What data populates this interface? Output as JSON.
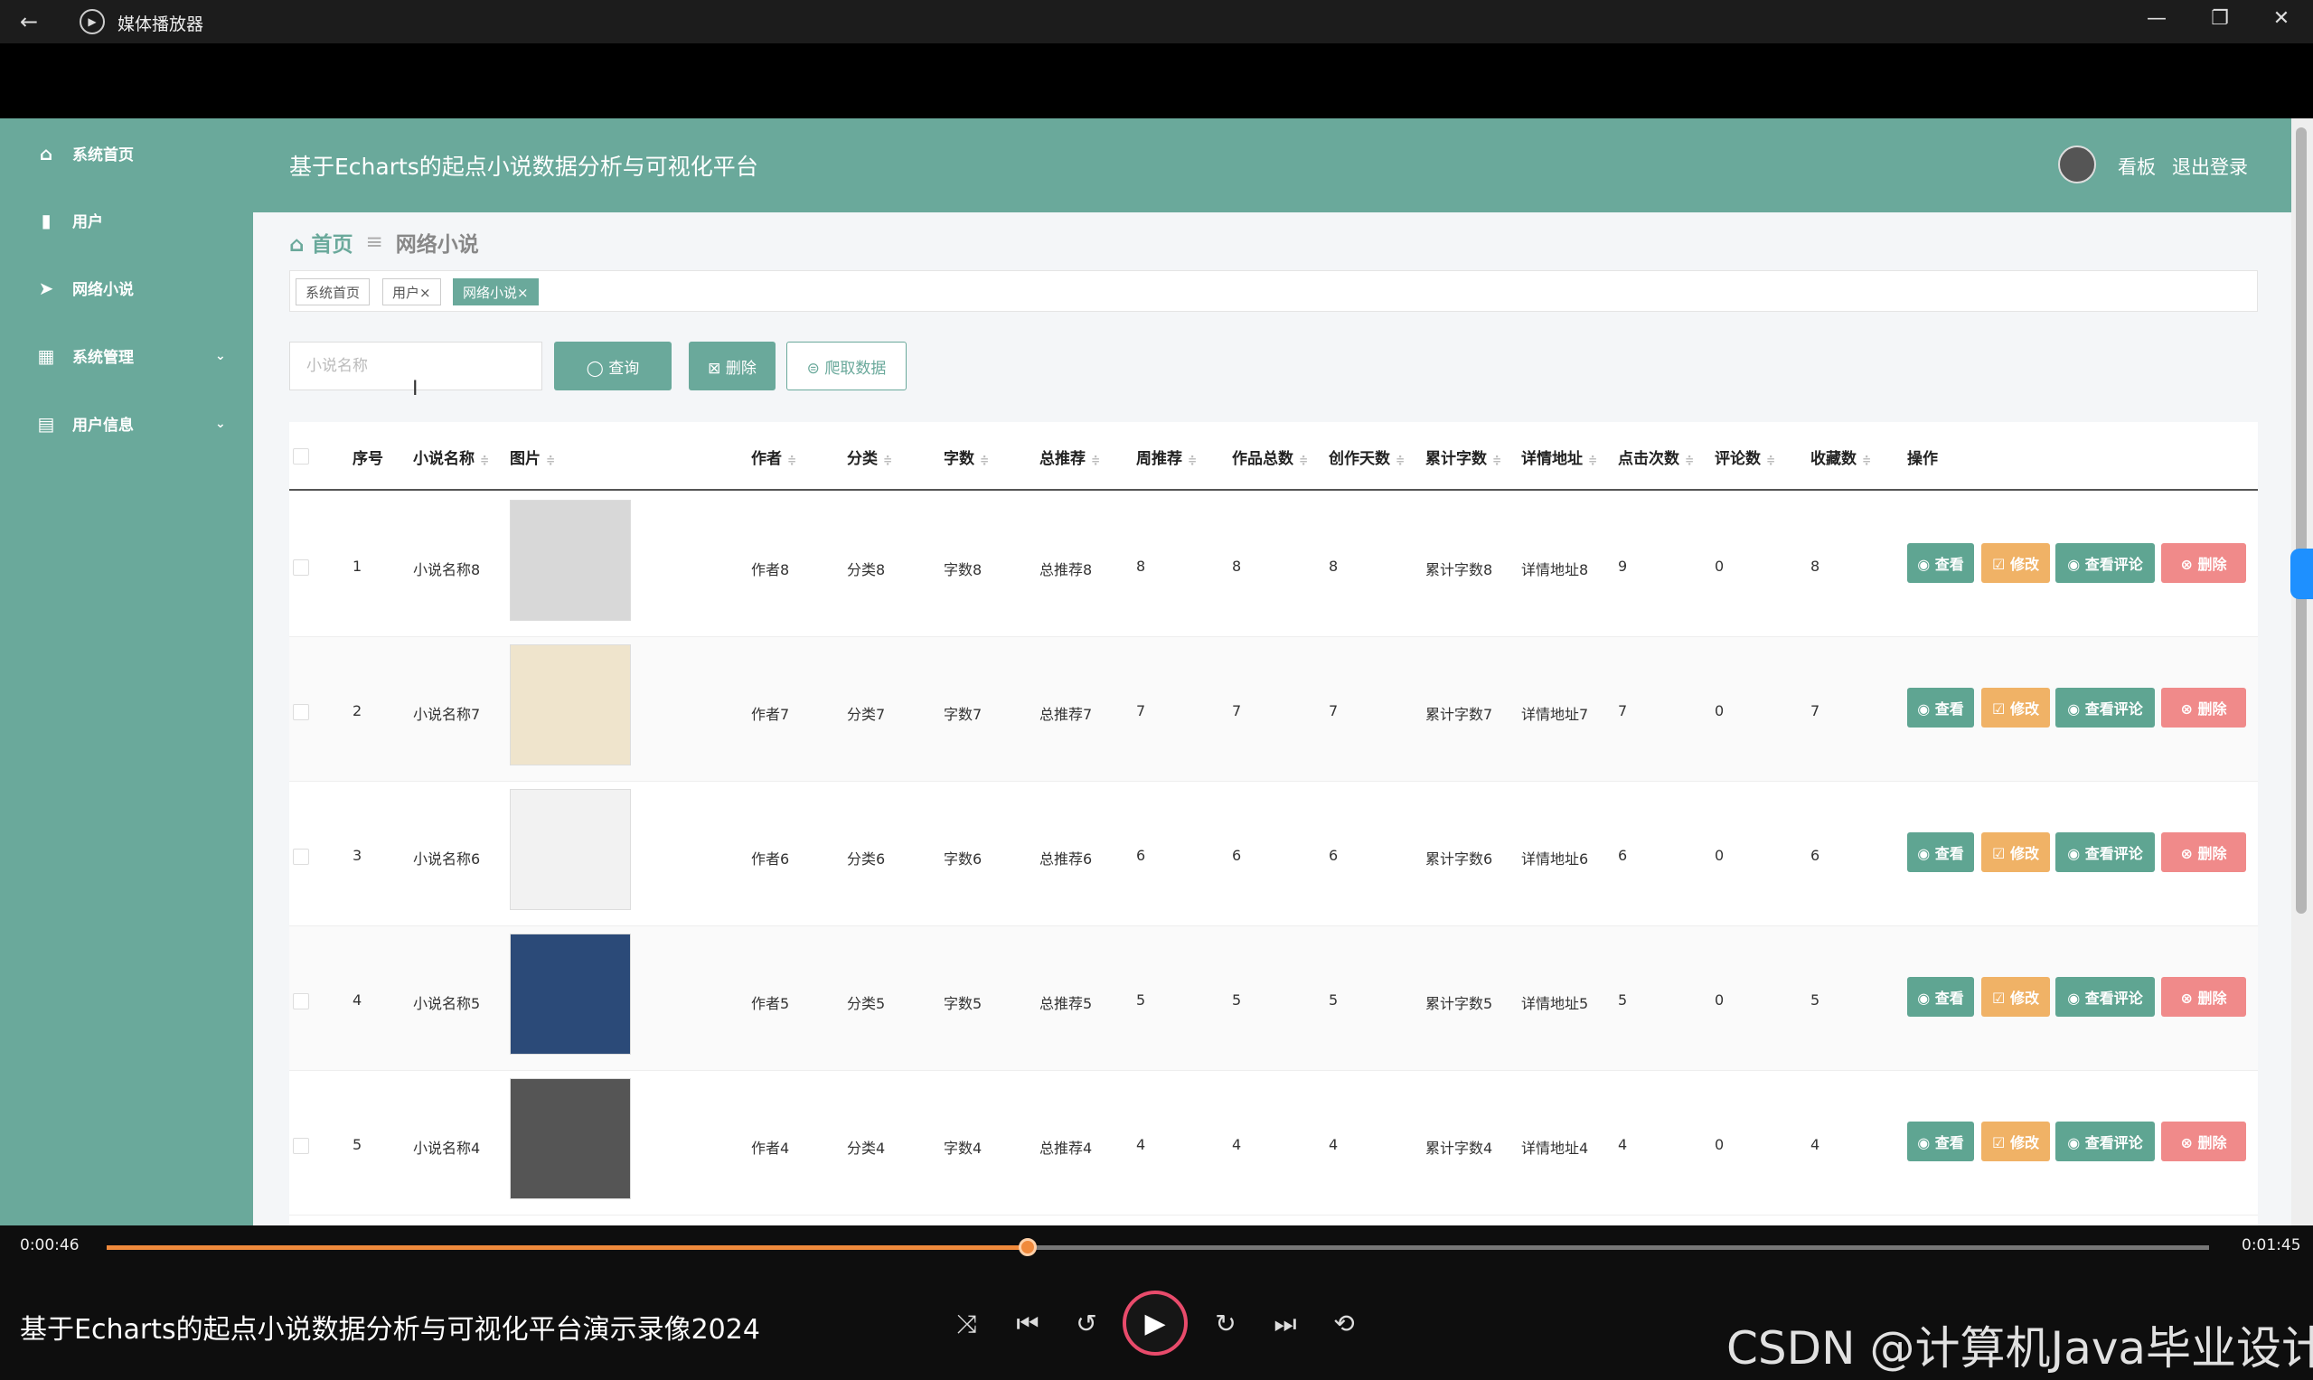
{
  "window": {
    "title": "媒体播放器",
    "back_glyph": "←",
    "minimize_glyph": "—",
    "maximize_glyph": "❐",
    "close_glyph": "✕"
  },
  "sidebar": {
    "items": [
      {
        "label": "系统首页",
        "icon": "home-icon",
        "glyph": "⌂"
      },
      {
        "label": "用户",
        "icon": "bar-chart-icon",
        "glyph": "▮"
      },
      {
        "label": "网络小说",
        "icon": "send-icon",
        "glyph": "➤"
      },
      {
        "label": "系统管理",
        "icon": "grid-icon",
        "glyph": "▦",
        "chevron": "⌄"
      },
      {
        "label": "用户信息",
        "icon": "card-icon",
        "glyph": "▤",
        "chevron": "⌄"
      }
    ]
  },
  "header": {
    "title": "基于Echarts的起点小说数据分析与可视化平台",
    "dashboard_link": "看板",
    "logout_link": "退出登录"
  },
  "breadcrumb": {
    "home": "首页",
    "separator": "≡",
    "current": "网络小说"
  },
  "tags": [
    {
      "label": "系统首页"
    },
    {
      "label": "用户×"
    },
    {
      "label": "网络小说×"
    }
  ],
  "toolbar": {
    "search_placeholder": "小说名称",
    "query_label": "◯ 查询",
    "delete_label": "⊠ 删除",
    "crawl_label": "⊜ 爬取数据"
  },
  "table": {
    "columns": [
      "序号",
      "小说名称",
      "图片",
      "作者",
      "分类",
      "字数",
      "总推荐",
      "周推荐",
      "作品总数",
      "创作天数",
      "累计字数",
      "详情地址",
      "点击次数",
      "评论数",
      "收藏数",
      "操作"
    ],
    "sort_glyph": "≑",
    "action_labels": {
      "view": "◉ 查看",
      "edit": "☑ 修改",
      "view_comments": "◉ 查看评论",
      "delete": "⊗ 删除"
    },
    "rows": [
      {
        "index": "1",
        "name": "小说名称8",
        "author": "作者8",
        "category": "分类8",
        "words": "字数8",
        "total_rec": "总推荐8",
        "week_rec": "8",
        "works": "8",
        "days": "8",
        "cum_words": "累计字数8",
        "url": "详情地址8",
        "clicks": "9",
        "comments": "0",
        "favorites": "8",
        "cover": "#d8d8d8"
      },
      {
        "index": "2",
        "name": "小说名称7",
        "author": "作者7",
        "category": "分类7",
        "words": "字数7",
        "total_rec": "总推荐7",
        "week_rec": "7",
        "works": "7",
        "days": "7",
        "cum_words": "累计字数7",
        "url": "详情地址7",
        "clicks": "7",
        "comments": "0",
        "favorites": "7",
        "cover": "#efe4cc"
      },
      {
        "index": "3",
        "name": "小说名称6",
        "author": "作者6",
        "category": "分类6",
        "words": "字数6",
        "total_rec": "总推荐6",
        "week_rec": "6",
        "works": "6",
        "days": "6",
        "cum_words": "累计字数6",
        "url": "详情地址6",
        "clicks": "6",
        "comments": "0",
        "favorites": "6",
        "cover": "#f2f2f2"
      },
      {
        "index": "4",
        "name": "小说名称5",
        "author": "作者5",
        "category": "分类5",
        "words": "字数5",
        "total_rec": "总推荐5",
        "week_rec": "5",
        "works": "5",
        "days": "5",
        "cum_words": "累计字数5",
        "url": "详情地址5",
        "clicks": "5",
        "comments": "0",
        "favorites": "5",
        "cover": "#2b4a78"
      },
      {
        "index": "5",
        "name": "小说名称4",
        "author": "作者4",
        "category": "分类4",
        "words": "字数4",
        "total_rec": "总推荐4",
        "week_rec": "4",
        "works": "4",
        "days": "4",
        "cum_words": "累计字数4",
        "url": "详情地址4",
        "clicks": "4",
        "comments": "0",
        "favorites": "4",
        "cover": "#555555"
      }
    ]
  },
  "player": {
    "current_time": "0:00:46",
    "total_time": "0:01:45",
    "progress_fraction": 0.438,
    "video_title": "基于Echarts的起点小说数据分析与可视化平台演示录像2024",
    "watermark": "CSDN @计算机Java毕业设计",
    "controls": {
      "shuffle": "⤨",
      "previous": "⏮",
      "rewind": "↺",
      "play": "▶",
      "forward": "↻",
      "next": "⏭",
      "repeat": "⟲"
    }
  },
  "colors": {
    "primary": "#6aa99b",
    "view": "#5fa592",
    "edit": "#f0b266",
    "comments": "#5fa592",
    "delete": "#f08a8a",
    "progress": "#f08a3c",
    "play_ring": "#e84b6b"
  }
}
